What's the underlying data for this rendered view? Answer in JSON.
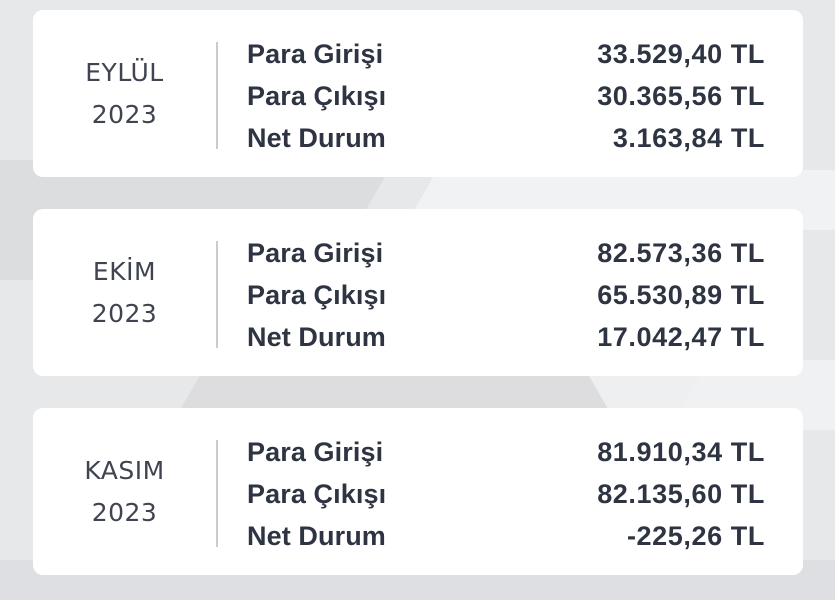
{
  "colors": {
    "card_bg": "#ffffff",
    "page_bg": "#e7e8ea",
    "text": "#2e3442",
    "divider": "#c9cbcf"
  },
  "cards": [
    {
      "month": "EYLÜL",
      "year": "2023",
      "rows": [
        {
          "label": "Para Girişi",
          "value": "33.529,40 TL"
        },
        {
          "label": "Para Çıkışı",
          "value": "30.365,56 TL"
        },
        {
          "label": "Net Durum",
          "value": "3.163,84 TL"
        }
      ]
    },
    {
      "month": "EKİM",
      "year": "2023",
      "rows": [
        {
          "label": "Para Girişi",
          "value": "82.573,36 TL"
        },
        {
          "label": "Para Çıkışı",
          "value": "65.530,89 TL"
        },
        {
          "label": "Net Durum",
          "value": "17.042,47 TL"
        }
      ]
    },
    {
      "month": "KASIM",
      "year": "2023",
      "rows": [
        {
          "label": "Para Girişi",
          "value": "81.910,34 TL"
        },
        {
          "label": "Para Çıkışı",
          "value": "82.135,60 TL"
        },
        {
          "label": "Net Durum",
          "value": "-225,26 TL"
        }
      ]
    }
  ]
}
